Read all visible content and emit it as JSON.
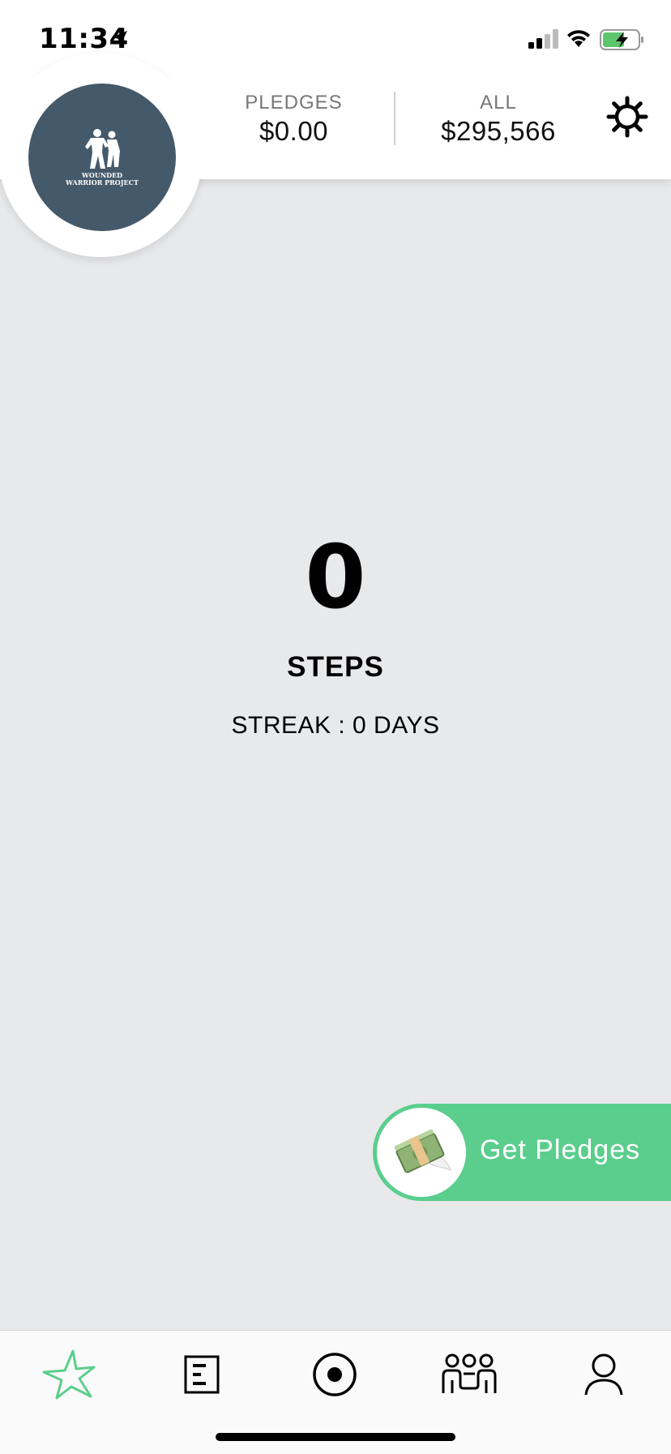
{
  "status_bar": {
    "time": "11:34",
    "icons": [
      "location-arrow-icon",
      "cellular-signal-icon",
      "wifi-icon",
      "battery-charging-icon"
    ]
  },
  "header": {
    "logo_text": "WOUNDED WARRIOR PROJECT",
    "pledges_label": "PLEDGES",
    "pledges_value": "$0.00",
    "all_label": "ALL",
    "all_value": "$295,566",
    "settings_icon": "gear-icon"
  },
  "main": {
    "steps_count": "0",
    "steps_label": "STEPS",
    "streak": "STREAK : 0 DAYS"
  },
  "pledge_button": {
    "label": "Get Pledges",
    "icon": "money-with-wings-icon"
  },
  "tabbar": {
    "tabs": [
      {
        "icon": "burst-icon",
        "active": true
      },
      {
        "icon": "document-list-icon",
        "active": false
      },
      {
        "icon": "record-target-icon",
        "active": false
      },
      {
        "icon": "team-icon",
        "active": false
      },
      {
        "icon": "profile-icon",
        "active": false
      }
    ]
  },
  "colors": {
    "accent_green": "#5bce8d",
    "logo_bg": "#44596a",
    "background": "#e8e9eb"
  }
}
